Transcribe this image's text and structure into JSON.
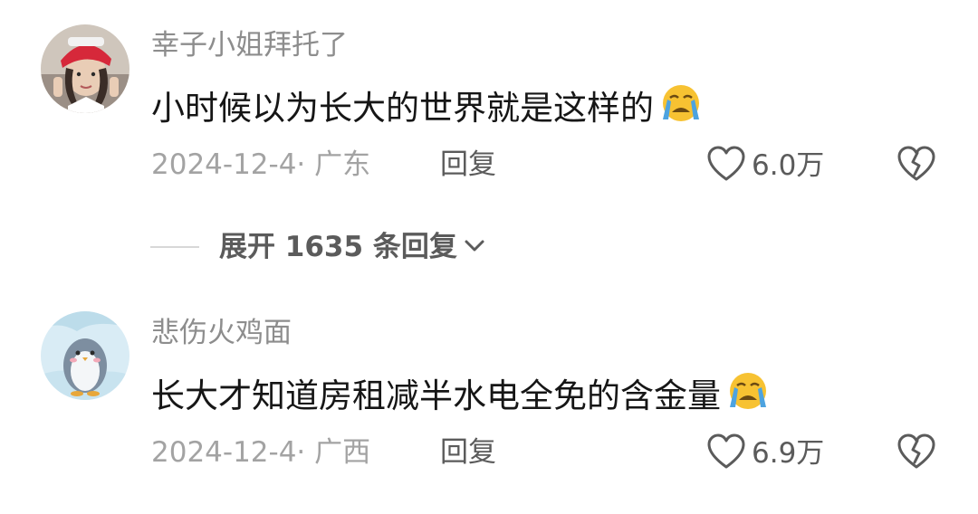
{
  "comments": [
    {
      "username": "幸子小姐拜托了",
      "content": "小时候以为长大的世界就是这样的",
      "emoji": "loudly-crying-emoji",
      "date_location": "2024-12-4· 广东",
      "reply_label": "回复",
      "likes": "6.0万"
    },
    {
      "username": "悲伤火鸡面",
      "content": "长大才知道房租减半水电全免的含金量",
      "emoji": "loudly-crying-emoji",
      "date_location": "2024-12-4· 广西",
      "reply_label": "回复",
      "likes": "6.9万"
    }
  ],
  "expand_replies": {
    "label": "展开 1635 条回复"
  },
  "icons": {
    "like": "heart-outline-icon",
    "dislike": "broken-heart-icon",
    "expand": "chevron-down-icon"
  },
  "colors": {
    "username": "#8d8d8d",
    "content": "#161616",
    "meta": "#a3a3a3",
    "action": "#5b5b5b",
    "emoji_face": "#f7c232",
    "emoji_tears": "#4da3e0"
  }
}
